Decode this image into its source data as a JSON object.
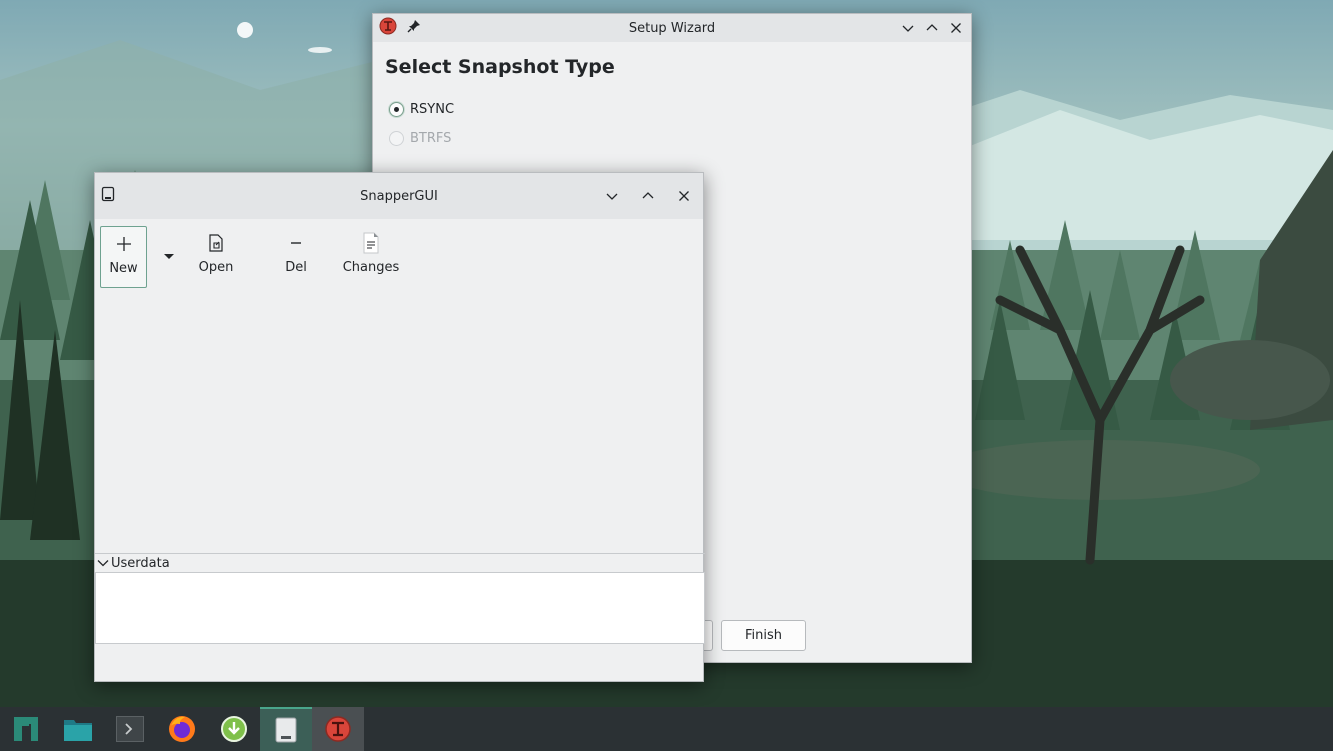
{
  "wizard": {
    "title": "Setup Wizard",
    "heading": "Select Snapshot Type",
    "options": [
      {
        "label": "RSYNC",
        "checked": true,
        "enabled": true
      },
      {
        "label": "BTRFS",
        "checked": false,
        "enabled": false
      }
    ],
    "finish_label": "Finish"
  },
  "snapper": {
    "title": "SnapperGUI",
    "toolbar": {
      "new_label": "New",
      "open_label": "Open",
      "del_label": "Del",
      "changes_label": "Changes"
    },
    "userdata_label": "Userdata"
  },
  "taskbar": {
    "items": [
      "app-menu-icon",
      "file-manager-icon",
      "terminal-icon",
      "firefox-icon",
      "update-icon",
      "snappergui-icon",
      "timeshift-icon"
    ]
  },
  "colors": {
    "accent": "#4aa68c",
    "taskbar": "#2b3134",
    "window_bg": "#eff0f1",
    "timeshift_red": "#d9453a"
  }
}
